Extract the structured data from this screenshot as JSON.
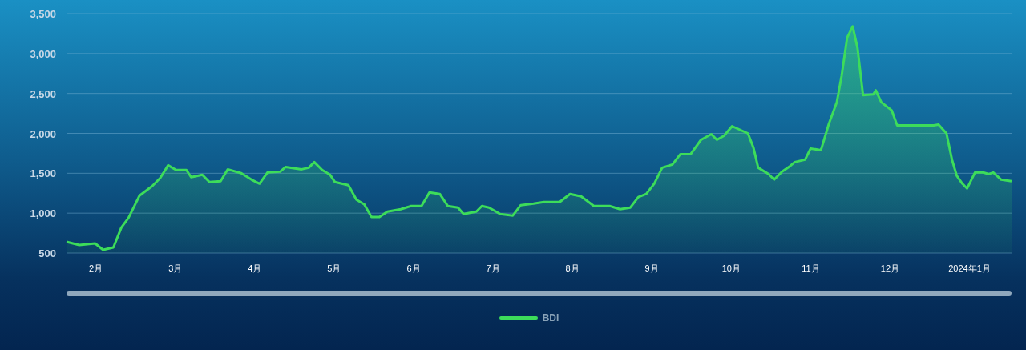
{
  "chart": {
    "chart_data": {
      "type": "area",
      "grid": true,
      "xlim": [
        1.63,
        13.53
      ],
      "ylim": [
        500,
        3500
      ],
      "yticks": [
        {
          "value": 500,
          "label": "500"
        },
        {
          "value": 1000,
          "label": "1,000"
        },
        {
          "value": 1500,
          "label": "1,500"
        },
        {
          "value": 2000,
          "label": "2,000"
        },
        {
          "value": 2500,
          "label": "2,500"
        },
        {
          "value": 3000,
          "label": "3,000"
        },
        {
          "value": 3500,
          "label": "3,500"
        }
      ],
      "xticks": [
        {
          "value": 2,
          "label": "2月"
        },
        {
          "value": 3,
          "label": "3月"
        },
        {
          "value": 4,
          "label": "4月"
        },
        {
          "value": 5,
          "label": "5月"
        },
        {
          "value": 6,
          "label": "6月"
        },
        {
          "value": 7,
          "label": "7月"
        },
        {
          "value": 8,
          "label": "8月"
        },
        {
          "value": 9,
          "label": "9月"
        },
        {
          "value": 10,
          "label": "10月"
        },
        {
          "value": 11,
          "label": "11月"
        },
        {
          "value": 12,
          "label": "12月"
        },
        {
          "value": 13,
          "label": "2024年1月"
        }
      ],
      "x": [
        1.63,
        1.79,
        1.99,
        2.09,
        2.22,
        2.32,
        2.41,
        2.55,
        2.71,
        2.81,
        2.91,
        3.01,
        3.14,
        3.2,
        3.34,
        3.43,
        3.57,
        3.66,
        3.83,
        3.96,
        4.06,
        4.16,
        4.32,
        4.39,
        4.59,
        4.68,
        4.75,
        4.85,
        4.95,
        5.01,
        5.18,
        5.28,
        5.38,
        5.47,
        5.57,
        5.67,
        5.84,
        5.97,
        6.1,
        6.2,
        6.33,
        6.43,
        6.56,
        6.63,
        6.79,
        6.86,
        6.95,
        7.09,
        7.25,
        7.35,
        7.51,
        7.64,
        7.84,
        7.97,
        8.11,
        8.27,
        8.47,
        8.6,
        8.73,
        8.83,
        8.93,
        9.03,
        9.13,
        9.26,
        9.36,
        9.49,
        9.62,
        9.75,
        9.82,
        9.91,
        10.01,
        10.21,
        10.28,
        10.34,
        10.47,
        10.54,
        10.64,
        10.74,
        10.8,
        10.93,
        11.0,
        11.13,
        11.23,
        11.33,
        11.39,
        11.46,
        11.53,
        11.59,
        11.66,
        11.79,
        11.82,
        11.89,
        12.02,
        12.09,
        12.55,
        12.61,
        12.71,
        12.78,
        12.84,
        12.91,
        12.97,
        13.07,
        13.17,
        13.24,
        13.3,
        13.4,
        13.53
      ],
      "series": [
        {
          "name": "BDI",
          "color": "#3ddc5a",
          "values": [
            640,
            600,
            620,
            540,
            570,
            820,
            940,
            1220,
            1340,
            1440,
            1600,
            1540,
            1540,
            1450,
            1480,
            1390,
            1400,
            1550,
            1500,
            1420,
            1370,
            1510,
            1520,
            1580,
            1550,
            1570,
            1640,
            1540,
            1480,
            1390,
            1350,
            1170,
            1110,
            950,
            950,
            1020,
            1050,
            1090,
            1090,
            1260,
            1240,
            1090,
            1070,
            990,
            1020,
            1090,
            1070,
            990,
            970,
            1100,
            1120,
            1140,
            1140,
            1240,
            1210,
            1090,
            1090,
            1050,
            1070,
            1200,
            1240,
            1370,
            1570,
            1610,
            1740,
            1740,
            1920,
            1990,
            1920,
            1970,
            2090,
            2000,
            1820,
            1570,
            1490,
            1420,
            1520,
            1590,
            1640,
            1670,
            1810,
            1790,
            2120,
            2390,
            2720,
            3200,
            3340,
            3070,
            2480,
            2490,
            2540,
            2390,
            2290,
            2100,
            2100,
            2110,
            2000,
            1670,
            1470,
            1370,
            1310,
            1510,
            1510,
            1490,
            1510,
            1420,
            1400
          ]
        }
      ]
    }
  }
}
